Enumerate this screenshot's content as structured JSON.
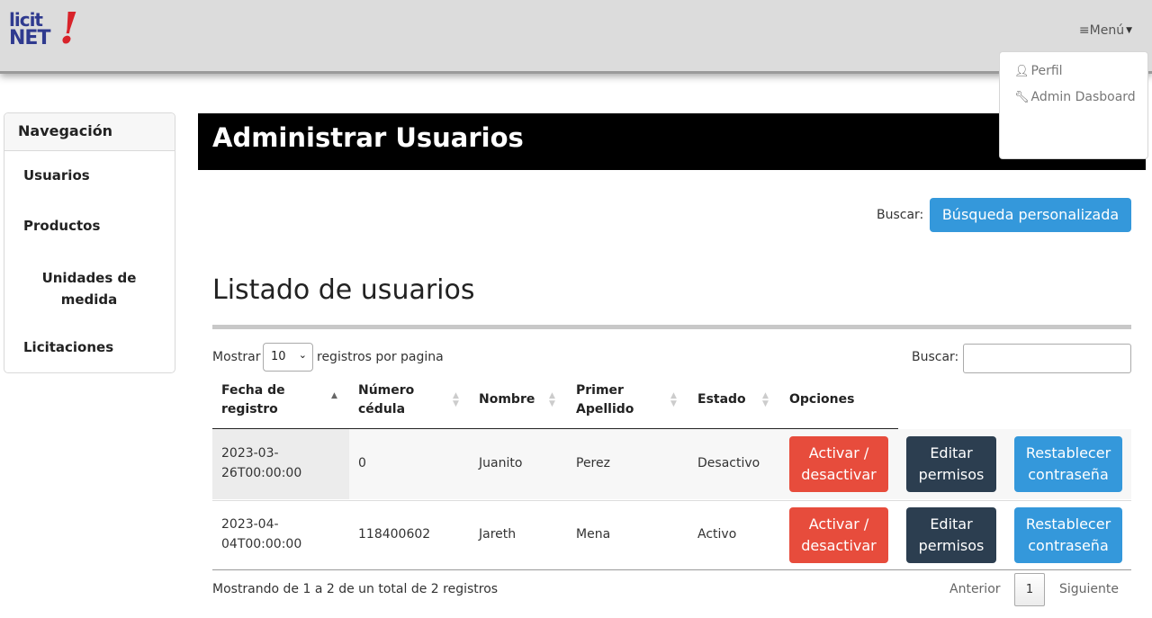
{
  "header": {
    "logo_top": "licit",
    "logo_bottom": "NET",
    "logo_mark": "!",
    "menu_label": "≡Menú",
    "dropdown": [
      {
        "icon": "user-icon",
        "label": "Perfil"
      },
      {
        "icon": "wrench-icon",
        "label": "Admin Dasboard"
      }
    ]
  },
  "sidebar": {
    "title": "Navegación",
    "items": [
      {
        "label": "Usuarios"
      },
      {
        "label": "Productos"
      },
      {
        "label": "Unidades de medida"
      },
      {
        "label": "Licitaciones"
      }
    ]
  },
  "main": {
    "title": "Administrar Usuarios",
    "search_label": "Buscar:",
    "custom_search_button": "Búsqueda personalizada",
    "list_title": "Listado de usuarios",
    "show_label": "Mostrar",
    "page_size": "10",
    "per_page_label": "registros por pagina",
    "table_search_label": "Buscar:",
    "columns": [
      {
        "label": "Fecha de registro"
      },
      {
        "label": "Número cédula"
      },
      {
        "label": "Nombre"
      },
      {
        "label": "Primer Apellido"
      },
      {
        "label": "Estado"
      },
      {
        "label": "Opciones"
      }
    ],
    "rows": [
      {
        "fecha": "2023-03-26T00:00:00",
        "cedula": "0",
        "nombre": "Juanito",
        "apellido": "Perez",
        "estado": "Desactivo"
      },
      {
        "fecha": "2023-04-04T00:00:00",
        "cedula": "118400602",
        "nombre": "Jareth",
        "apellido": "Mena",
        "estado": "Activo"
      }
    ],
    "buttons": {
      "toggle": "Activar / desactivar",
      "permissions": "Editar permisos",
      "reset": "Restablecer contraseña"
    },
    "summary": "Mostrando de 1 a 2 de un total de 2 registros",
    "pagination": {
      "prev": "Anterior",
      "current": "1",
      "next": "Siguiente"
    }
  },
  "colors": {
    "red": "#e74c3c",
    "dark": "#2c3e50",
    "blue": "#3498db",
    "header_black": "#000000",
    "logo_blue": "#2f3a8f",
    "logo_red": "#d8232a"
  }
}
